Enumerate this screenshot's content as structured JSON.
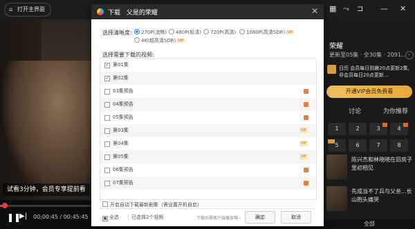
{
  "topbar": {
    "home_label": "打开主界面",
    "right_icons": [
      "grid-icon",
      "share-icon",
      "pip-icon",
      "minimize-icon",
      "close-icon"
    ]
  },
  "player": {
    "caption": "试看3分钟，会员专享提前看",
    "time": "00:00:45 / 00:45:45",
    "progress": 0.016
  },
  "panel": {
    "title": "荣耀",
    "meta": "更新至05集 · 全30集 · 2091...",
    "calendar_text": "日历 会员每日到晨20点更新2集, 非会员每日20点更新...",
    "vip_button": "开通VIP会员免费看",
    "tabs": [
      "讨论",
      "为你推荐"
    ],
    "episodes": [
      "1",
      "2",
      "3",
      "4",
      "5",
      "6",
      "7",
      "8"
    ],
    "recs": [
      {
        "text": "陈兴杰和林晓晓在旧房子里初相见"
      },
      {
        "text": "先成当不了兵与父亲...长山抱头痛哭"
      }
    ],
    "all_label": "全部"
  },
  "dialog": {
    "header_prefix": "下载",
    "header_title": "父是的荣耀",
    "quality_label": "选择清晰度:",
    "qualities": [
      {
        "label": "270P(流畅)",
        "selected": true,
        "vip": false
      },
      {
        "label": "480P(标清)",
        "selected": false,
        "vip": false
      },
      {
        "label": "720P(高清)",
        "selected": false,
        "vip": false
      },
      {
        "label": "1080P(高清SDR)",
        "selected": false,
        "vip": true
      },
      {
        "label": "4K(超高清SDR)",
        "selected": false,
        "vip": true
      }
    ],
    "vip_tag": "VIP",
    "select_label": "选择需要下载的视频:",
    "episodes": [
      {
        "label": "第01集",
        "checked": true,
        "tag": ""
      },
      {
        "label": "第02集",
        "checked": true,
        "tag": ""
      },
      {
        "label": "03集预告",
        "checked": false,
        "tag": "preview"
      },
      {
        "label": "04集预告",
        "checked": false,
        "tag": "preview"
      },
      {
        "label": "05集预告",
        "checked": false,
        "tag": "preview"
      },
      {
        "label": "第03集",
        "checked": false,
        "tag": "VIP"
      },
      {
        "label": "第04集",
        "checked": false,
        "tag": "VIP"
      },
      {
        "label": "第05集",
        "checked": false,
        "tag": "VIP"
      },
      {
        "label": "06集预告",
        "checked": false,
        "tag": "preview"
      },
      {
        "label": "07集预告",
        "checked": false,
        "tag": "preview"
      }
    ],
    "auto_download": "开启自动下载最新剧集（需设置开机自启）",
    "select_all": "全选",
    "selected_count": "已选择2个视频",
    "hint": "下载后需客户端播放哦~",
    "confirm": "确定",
    "cancel": "取消"
  }
}
